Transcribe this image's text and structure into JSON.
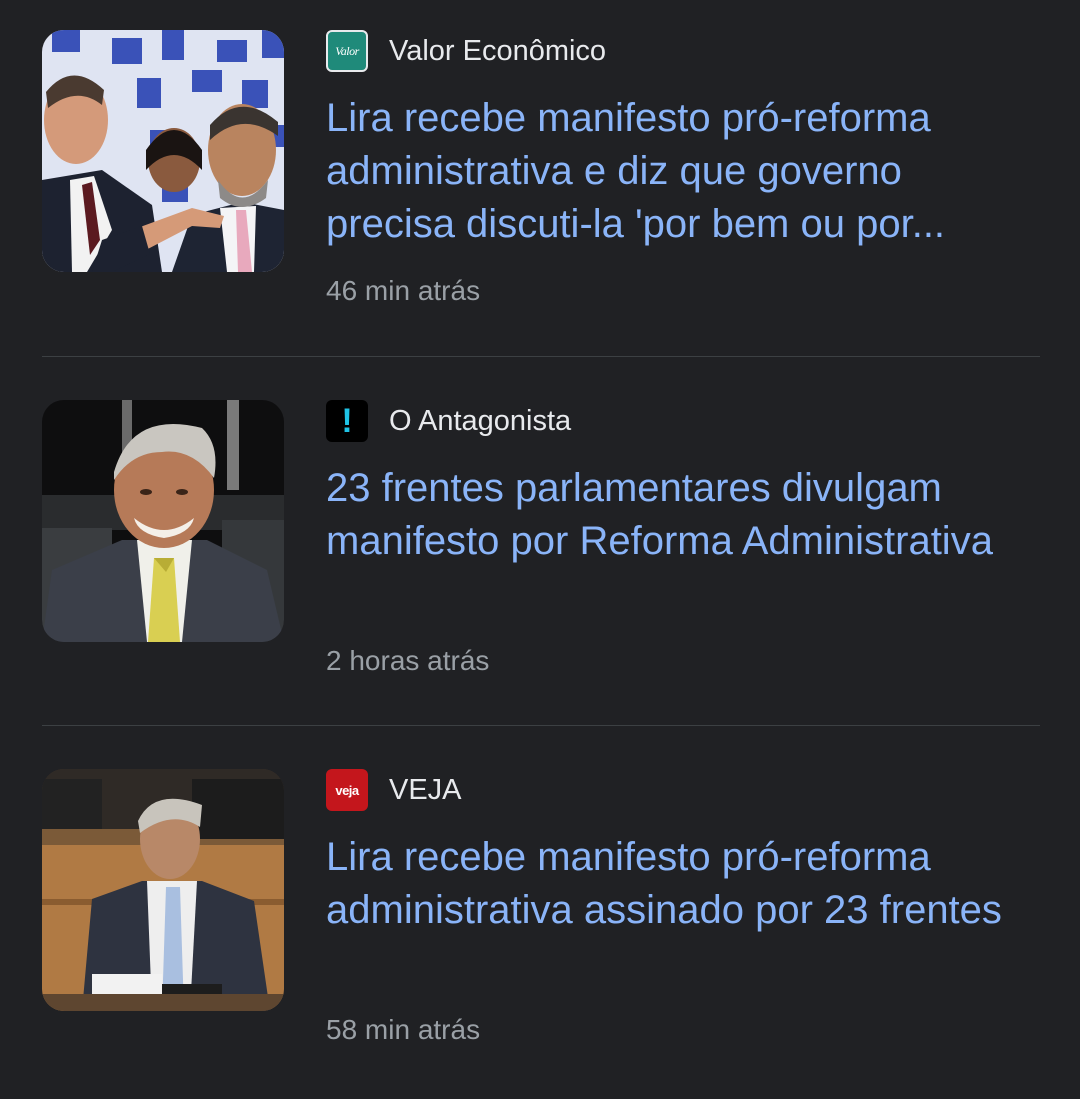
{
  "articles": [
    {
      "source": "Valor Econômico",
      "logo_text": "Valor",
      "logo_icon": "valor-logo-icon",
      "headline": "Lira recebe manifesto pró-reforma administrativa e diz que governo precisa discuti-la 'por bem ou por...",
      "time": "46 min atrás",
      "thumbnail": "photo-two-men-gesturing-blue-background"
    },
    {
      "source": "O Antagonista",
      "logo_text": "!",
      "logo_icon": "exclamation-logo-icon",
      "headline": "23 frentes parlamentares divulgam manifesto por Reforma Administrativa",
      "time": "2 horas atrás",
      "thumbnail": "photo-smiling-man-suit-yellow-tie"
    },
    {
      "source": "VEJA",
      "logo_text": "veja",
      "logo_icon": "veja-logo-icon",
      "headline": "Lira recebe manifesto pró-reforma administrativa assinado por 23 frentes",
      "time": "58 min atrás",
      "thumbnail": "photo-man-seated-wood-panel-chamber"
    }
  ],
  "colors": {
    "background": "#202124",
    "headline": "#8ab4f8",
    "source": "#e8eaed",
    "time": "#9aa0a6",
    "divider": "#3c4043",
    "veja_red": "#c4161c",
    "antagonista_cyan": "#1fc3e6",
    "valor_teal": "#1f8a7a"
  }
}
